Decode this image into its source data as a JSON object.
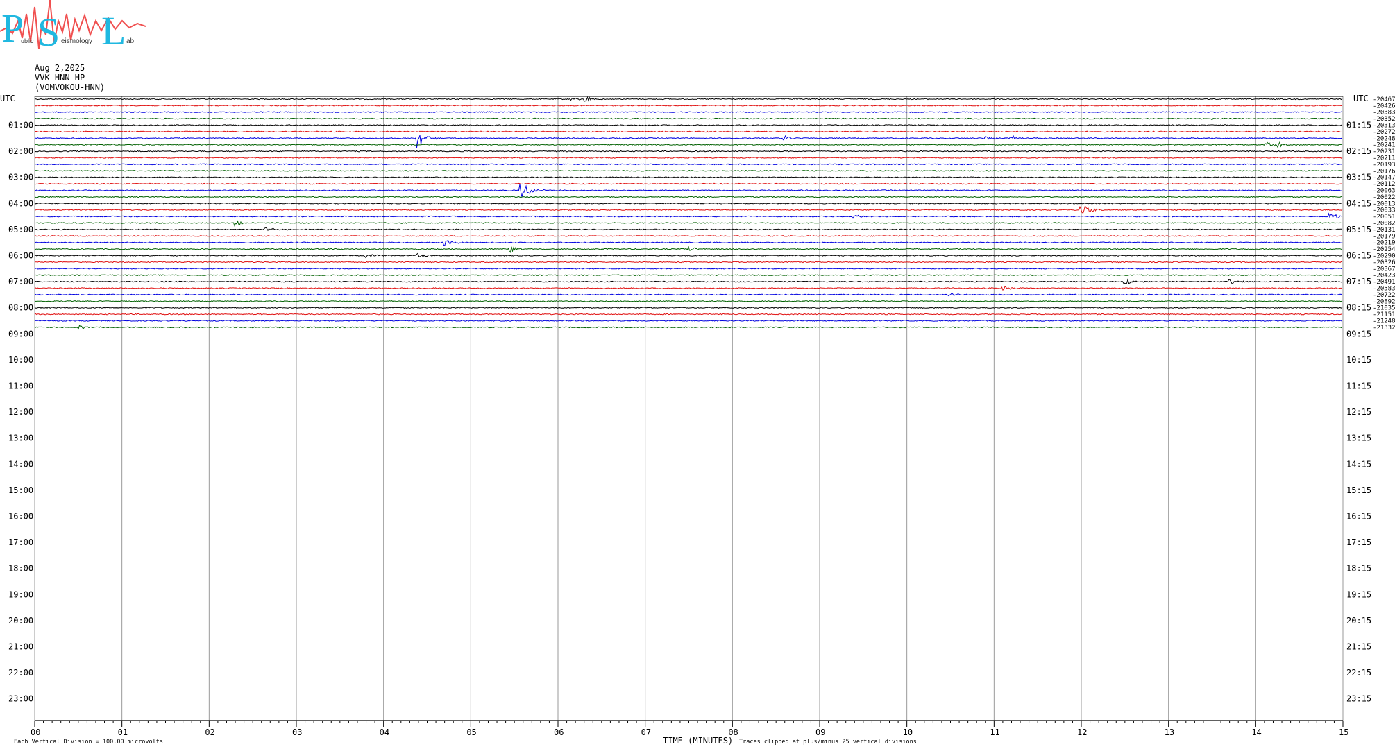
{
  "header": {
    "date": "Aug 2,2025",
    "station": "VVK HNN HP --",
    "network": "(VOMVOKOU-HNN)"
  },
  "logo": {
    "letters": [
      "P",
      "S",
      "L"
    ],
    "word1": "ublic",
    "word2": "eismology",
    "word3": "ab"
  },
  "colors": {
    "black": "#000000",
    "red": "#e01010",
    "blue": "#0000e0",
    "green": "#006000",
    "grid": "#9a9a9a"
  },
  "chart_data": {
    "type": "line",
    "xlabel": "TIME (MINUTES)",
    "xlim": [
      0,
      15
    ],
    "x_ticks": [
      "00",
      "01",
      "02",
      "03",
      "04",
      "05",
      "06",
      "07",
      "08",
      "09",
      "10",
      "11",
      "12",
      "13",
      "14",
      "15"
    ],
    "left_axis_title": "UTC",
    "right_axis_title": "UTC",
    "left_hour_labels": [
      "01:00",
      "02:00",
      "03:00",
      "04:00",
      "05:00",
      "06:00",
      "07:00",
      "08:00",
      "09:00",
      "10:00",
      "11:00",
      "12:00",
      "13:00",
      "14:00",
      "15:00",
      "16:00",
      "17:00",
      "18:00",
      "19:00",
      "20:00",
      "21:00",
      "22:00",
      "23:00"
    ],
    "right_hour_labels": [
      "01:15",
      "02:15",
      "03:15",
      "04:15",
      "05:15",
      "06:15",
      "07:15",
      "08:15",
      "09:15",
      "10:15",
      "11:15",
      "12:15",
      "13:15",
      "14:15",
      "15:15",
      "16:15",
      "17:15",
      "18:15",
      "19:15",
      "20:15",
      "21:15",
      "22:15",
      "23:15"
    ],
    "traces_per_hour": 4,
    "trace_color_cycle": [
      "black",
      "red",
      "blue",
      "green"
    ],
    "trace_offsets": [
      "-20467",
      "-20426",
      "-20383",
      "-20352",
      "-20313",
      "-20272",
      "-20248",
      "-20241",
      "-20231",
      "-20211",
      "-20193",
      "-20176",
      "-20147",
      "-20112",
      "-20063",
      "-20022",
      "-20013",
      "-20033",
      "-20051",
      "-20082",
      "-20131",
      "-20179",
      "-20219",
      "-20254",
      "-20290",
      "-20326",
      "-20367",
      "-20423",
      "-20491",
      "-20583",
      "-20722",
      "-20892",
      "-21035",
      "-21151",
      "-21248",
      "-21332"
    ],
    "events": [
      {
        "trace": 0,
        "minute": 6.15,
        "amp": 3
      },
      {
        "trace": 0,
        "minute": 6.32,
        "amp": 4
      },
      {
        "trace": 0,
        "minute": 8.7,
        "amp": 2
      },
      {
        "trace": 3,
        "minute": 13.5,
        "amp": 2
      },
      {
        "trace": 6,
        "minute": 4.4,
        "amp": 14
      },
      {
        "trace": 6,
        "minute": 8.6,
        "amp": 3
      },
      {
        "trace": 6,
        "minute": 10.9,
        "amp": 3
      },
      {
        "trace": 6,
        "minute": 11.2,
        "amp": 4
      },
      {
        "trace": 7,
        "minute": 14.1,
        "amp": 6
      },
      {
        "trace": 7,
        "minute": 14.25,
        "amp": 4
      },
      {
        "trace": 14,
        "minute": 5.58,
        "amp": 14
      },
      {
        "trace": 14,
        "minute": 10.3,
        "amp": 2
      },
      {
        "trace": 17,
        "minute": 12.0,
        "amp": 9
      },
      {
        "trace": 18,
        "minute": 14.85,
        "amp": 6
      },
      {
        "trace": 18,
        "minute": 9.4,
        "amp": 3
      },
      {
        "trace": 19,
        "minute": 2.3,
        "amp": 5
      },
      {
        "trace": 20,
        "minute": 2.65,
        "amp": 4
      },
      {
        "trace": 22,
        "minute": 4.7,
        "amp": 6
      },
      {
        "trace": 23,
        "minute": 5.45,
        "amp": 5
      },
      {
        "trace": 23,
        "minute": 7.5,
        "amp": 4
      },
      {
        "trace": 24,
        "minute": 3.8,
        "amp": 3
      },
      {
        "trace": 24,
        "minute": 4.4,
        "amp": 4
      },
      {
        "trace": 29,
        "minute": 11.1,
        "amp": 3
      },
      {
        "trace": 28,
        "minute": 12.5,
        "amp": 4
      },
      {
        "trace": 28,
        "minute": 13.7,
        "amp": 5
      },
      {
        "trace": 30,
        "minute": 10.5,
        "amp": 3
      },
      {
        "trace": 35,
        "minute": 0.5,
        "amp": 3
      }
    ]
  },
  "footer": {
    "scale_note": "Each Vertical Division =  100.00 microvolts",
    "clip_note": "Traces clipped at plus/minus 25 vertical divisions"
  }
}
